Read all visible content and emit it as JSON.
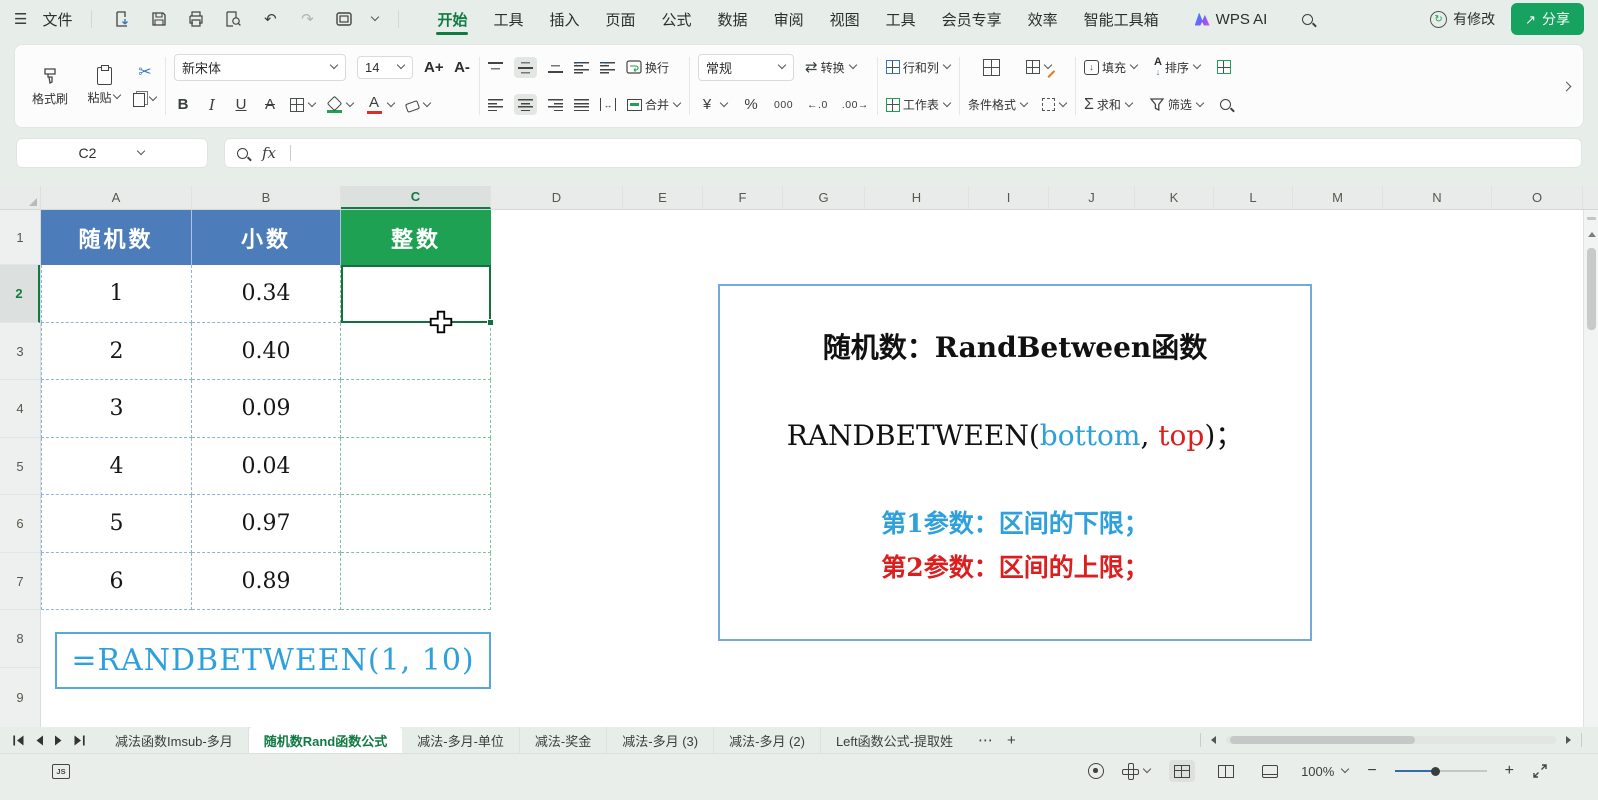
{
  "colors": {
    "brand_green": "#117A43",
    "share_green": "#15A35F",
    "table_header_blue": "#4D7CBB",
    "table_header_green": "#1EA153",
    "selection_green": "#15703F",
    "formula_blue": "#2EA0DB",
    "param_red": "#DD1E1E",
    "box_border_blue": "#74AADB",
    "accent_blue": "#3576C2"
  },
  "icons": {
    "hamburger": "☰",
    "undo": "↶",
    "redo": "↷",
    "scissors": "✂",
    "sync": "↻",
    "share_arrow": "↗",
    "bold": "B",
    "italic": "I",
    "underline": "U",
    "strike": "A",
    "grow_font": "A+",
    "shrink_font": "A-",
    "currency": "¥",
    "percent": "%",
    "thousands": "000",
    "inc_decimal": "←.0",
    "dec_decimal": ".00→",
    "convert_swap": "⇄",
    "orientation": "↔",
    "fill_arrow": "↓",
    "sum": "Σ",
    "sort_letter": "A",
    "sort_arrow": "↓",
    "indent_left_arrow": "←",
    "indent_right_arrow": "→",
    "fx": "fx",
    "js": "JS",
    "overflow_dots": "⋯",
    "add_tab": "+",
    "zoom_minus": "−",
    "zoom_plus": "+"
  },
  "topbar": {
    "file_menu": "文件",
    "menu_tabs": [
      {
        "label": "开始",
        "active": true
      },
      {
        "label": "工具"
      },
      {
        "label": "插入"
      },
      {
        "label": "页面"
      },
      {
        "label": "公式"
      },
      {
        "label": "数据"
      },
      {
        "label": "审阅"
      },
      {
        "label": "视图"
      },
      {
        "label": "工具"
      },
      {
        "label": "会员专享"
      },
      {
        "label": "效率"
      },
      {
        "label": "智能工具箱"
      }
    ],
    "wps_ai_label": "WPS AI",
    "modified_label": "有修改",
    "share_label": "分享"
  },
  "ribbon": {
    "format_painter": "格式刷",
    "paste": "粘贴",
    "font_name": "新宋体",
    "font_size": "14",
    "wrap_label": "换行",
    "merge_label": "合并",
    "number_format": "常规",
    "convert_label": "转换",
    "rows_cols_label": "行和列",
    "worksheet_label": "工作表",
    "conditional_format_label": "条件格式",
    "fill_label": "填充",
    "sort_label": "排序",
    "sum_label": "求和",
    "filter_label": "筛选"
  },
  "formula_bar": {
    "cell_reference": "C2"
  },
  "grid": {
    "columns": [
      "A",
      "B",
      "C",
      "D",
      "E",
      "F",
      "G",
      "H",
      "I",
      "J",
      "K",
      "L",
      "M",
      "N",
      "O"
    ],
    "rows": [
      "1",
      "2",
      "3",
      "4",
      "5",
      "6",
      "7",
      "8",
      "9"
    ],
    "selected_cell": "C2",
    "selected_column": "C",
    "selected_row": "2"
  },
  "table": {
    "headers": [
      "随机数",
      "小数",
      "整数"
    ],
    "rows": [
      [
        "1",
        "0.34"
      ],
      [
        "2",
        "0.40"
      ],
      [
        "3",
        "0.09"
      ],
      [
        "4",
        "0.04"
      ],
      [
        "5",
        "0.97"
      ],
      [
        "6",
        "0.89"
      ]
    ]
  },
  "formula_note": "=RANDBETWEEN(1, 10)",
  "info_box": {
    "title": "随机数：RandBetween函数",
    "syntax": [
      {
        "text": "RANDBETWEEN("
      },
      {
        "text": "bottom"
      },
      {
        "text": ", "
      },
      {
        "text": "top"
      },
      {
        "text": ")；"
      }
    ],
    "param1": "第1参数：区间的下限；",
    "param2": "第2参数：区间的上限；"
  },
  "sheet_tabs": {
    "tabs": [
      {
        "label": "减法函数Imsub-多月"
      },
      {
        "label": "随机数Rand函数公式",
        "active": true
      },
      {
        "label": "减法-多月-单位"
      },
      {
        "label": "减法-奖金"
      },
      {
        "label": "减法-多月 (3)"
      },
      {
        "label": "减法-多月 (2)"
      },
      {
        "label": "Left函数公式-提取姓"
      }
    ]
  },
  "status_bar": {
    "zoom_level": "100%"
  }
}
